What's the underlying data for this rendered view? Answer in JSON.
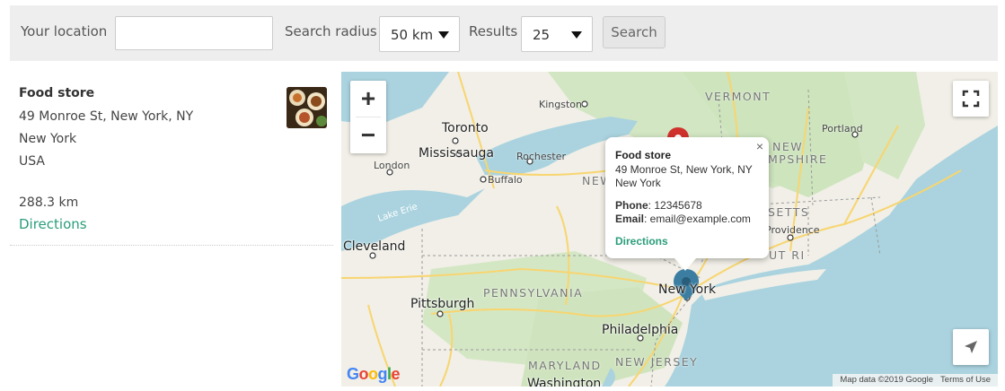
{
  "search": {
    "location_label": "Your location",
    "location_value": "",
    "radius_label": "Search radius",
    "radius_value": "50 km",
    "results_label": "Results",
    "results_value": "25",
    "search_button": "Search"
  },
  "result": {
    "title": "Food store",
    "address1": "49 Monroe St, New York, NY",
    "city": "New York",
    "country": "USA",
    "distance": "288.3 km",
    "directions": "Directions"
  },
  "map": {
    "labels": {
      "vermont": "VERMONT",
      "kingston": "Kingston",
      "toronto": "Toronto",
      "mississauga": "Mississauga",
      "rochester": "Rochester",
      "buffalo": "Buffalo",
      "london": "London",
      "lake_erie": "Lake Erie",
      "cleveland": "Cleveland",
      "pittsburgh": "Pittsburgh",
      "pennsylvania": "PENNSYLVANIA",
      "new_york_state": "NEW",
      "new_york_city": "New York",
      "philadelphia": "Philadelphia",
      "maryland": "MARYLAND",
      "new_jersey": "NEW JERSEY",
      "washington": "Washington",
      "portland": "Portland",
      "new_hampshire_1": "NEW",
      "new_hampshire_2": "MPSHIRE",
      "massachusetts": "SETTS",
      "providence": "Providence",
      "connecticut": "UT RI"
    },
    "popup": {
      "title": "Food store",
      "address1": "49 Monroe St, New York, NY",
      "address2": "New York",
      "phone_label": "Phone",
      "phone_value": ": 12345678",
      "email_label": "Email",
      "email_value": ": email@example.com",
      "directions": "Directions",
      "close": "×"
    },
    "controls": {
      "zoom_in": "+",
      "zoom_out": "−"
    },
    "attribution": {
      "map_data": "Map data ©2019 Google",
      "terms": "Terms of Use"
    },
    "google_logo": "Google",
    "colors": {
      "water": "#aad3df",
      "land": "#f3f1ea",
      "forest": "#cfe5c0",
      "highway": "#f8d56f",
      "marker": "#3b7ea1",
      "accent": "#2a9d7a"
    }
  }
}
